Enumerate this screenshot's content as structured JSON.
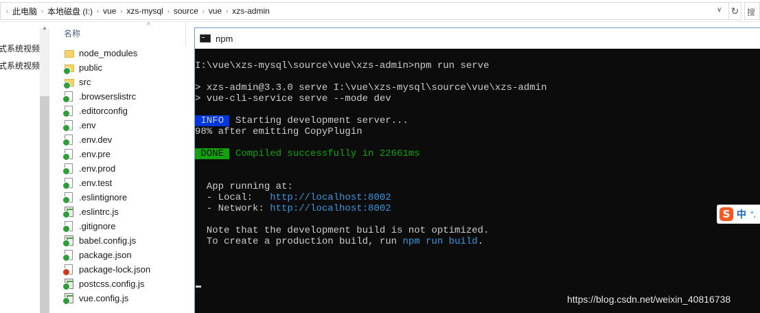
{
  "address_bar": {
    "crumbs": [
      "此电脑",
      "本地磁盘 (I:)",
      "vue",
      "xzs-mysql",
      "source",
      "vue",
      "xzs-admin"
    ],
    "search_placeholder": "搜"
  },
  "nav_pane": {
    "items": [
      "式系统视频教",
      "式系统视频教"
    ]
  },
  "file_list": {
    "column_name": "名称",
    "files": [
      {
        "name": "node_modules",
        "icon": "folder-icon"
      },
      {
        "name": "public",
        "icon": "folder-synced-icon"
      },
      {
        "name": "src",
        "icon": "folder-synced-icon"
      },
      {
        "name": ".browserslistrc",
        "icon": "file-synced-icon"
      },
      {
        "name": ".editorconfig",
        "icon": "file-synced-icon"
      },
      {
        "name": ".env",
        "icon": "file-synced-icon"
      },
      {
        "name": ".env.dev",
        "icon": "file-synced-icon"
      },
      {
        "name": ".env.pre",
        "icon": "file-synced-icon"
      },
      {
        "name": ".env.prod",
        "icon": "file-synced-icon"
      },
      {
        "name": ".env.test",
        "icon": "file-synced-icon"
      },
      {
        "name": ".eslintignore",
        "icon": "file-synced-icon"
      },
      {
        "name": ".eslintrc.js",
        "icon": "js-file-synced-icon"
      },
      {
        "name": ".gitignore",
        "icon": "file-synced-icon"
      },
      {
        "name": "babel.config.js",
        "icon": "js-file-synced-icon"
      },
      {
        "name": "package.json",
        "icon": "file-synced-icon"
      },
      {
        "name": "package-lock.json",
        "icon": "file-modified-icon"
      },
      {
        "name": "postcss.config.js",
        "icon": "js-file-synced-icon"
      },
      {
        "name": "vue.config.js",
        "icon": "js-file-synced-icon"
      }
    ]
  },
  "terminal": {
    "title": "npm",
    "prompt_line": "I:\\vue\\xzs-mysql\\source\\vue\\xzs-admin>npm run serve",
    "script_line_1": "> xzs-admin@3.3.0 serve I:\\vue\\xzs-mysql\\source\\vue\\xzs-admin",
    "script_line_2": "> vue-cli-service serve --mode dev",
    "info_badge": " INFO ",
    "info_text": " Starting development server...",
    "progress_line": "98% after emitting CopyPlugin",
    "done_badge": " DONE ",
    "done_text": " Compiled successfully in 22661ms",
    "app_running": "  App running at:",
    "local_label": "  - Local:   ",
    "local_url": "http://localhost:8002",
    "network_label": "  - Network: ",
    "network_url": "http://localhost:8002",
    "note_line": "  Note that the development build is not optimized.",
    "create_prefix": "  To create a production build, run ",
    "create_cmd": "npm run build",
    "create_suffix": "."
  },
  "ime": {
    "logo": "S",
    "lang": "中",
    "punct": "°,"
  },
  "watermark": "https://blog.csdn.net/weixin_40816738",
  "colors": {
    "terminal_bg": "#0c0c0c",
    "terminal_fg": "#cccccc",
    "info_badge_bg": "#0037da",
    "done_badge_bg": "#13a10e",
    "success_text": "#13a10e",
    "url_text": "#3a96dd"
  }
}
